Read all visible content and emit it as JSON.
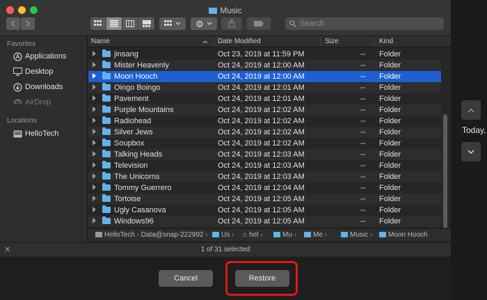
{
  "window": {
    "title": "Music"
  },
  "toolbar": {
    "back_icon": "chevron-left-icon",
    "forward_icon": "chevron-right-icon",
    "views": [
      "icon-view-icon",
      "list-view-icon",
      "column-view-icon",
      "gallery-view-icon"
    ],
    "active_view": 1,
    "search_placeholder": "Search"
  },
  "sidebar": {
    "favorites_header": "Favorites",
    "favorites": [
      {
        "label": "Applications",
        "icon": "applications-icon"
      },
      {
        "label": "Desktop",
        "icon": "desktop-icon"
      },
      {
        "label": "Downloads",
        "icon": "downloads-icon"
      },
      {
        "label": "AirDrop",
        "icon": "airdrop-icon"
      }
    ],
    "locations_header": "Locations",
    "locations": [
      {
        "label": "HelloTech",
        "icon": "computer-icon"
      }
    ]
  },
  "columns": {
    "name": "Name",
    "date": "Date Modified",
    "size": "Size",
    "kind": "Kind"
  },
  "rows": [
    {
      "name": "jinsang",
      "date": "Oct 23, 2019 at 11:59 PM",
      "size": "--",
      "kind": "Folder"
    },
    {
      "name": "Mister Heavenly",
      "date": "Oct 24, 2019 at 12:00 AM",
      "size": "--",
      "kind": "Folder"
    },
    {
      "name": "Moon Hooch",
      "date": "Oct 24, 2019 at 12:00 AM",
      "size": "--",
      "kind": "Folder",
      "selected": true
    },
    {
      "name": "Oingo Boingo",
      "date": "Oct 24, 2019 at 12:01 AM",
      "size": "--",
      "kind": "Folder"
    },
    {
      "name": "Pavement",
      "date": "Oct 24, 2019 at 12:01 AM",
      "size": "--",
      "kind": "Folder"
    },
    {
      "name": "Purple Mountains",
      "date": "Oct 24, 2019 at 12:02 AM",
      "size": "--",
      "kind": "Folder"
    },
    {
      "name": "Radiohead",
      "date": "Oct 24, 2019 at 12:02 AM",
      "size": "--",
      "kind": "Folder"
    },
    {
      "name": "Silver Jews",
      "date": "Oct 24, 2019 at 12:02 AM",
      "size": "--",
      "kind": "Folder"
    },
    {
      "name": "Soupbox",
      "date": "Oct 24, 2019 at 12:02 AM",
      "size": "--",
      "kind": "Folder"
    },
    {
      "name": "Talking Heads",
      "date": "Oct 24, 2019 at 12:03 AM",
      "size": "--",
      "kind": "Folder"
    },
    {
      "name": "Television",
      "date": "Oct 24, 2019 at 12:03 AM",
      "size": "--",
      "kind": "Folder"
    },
    {
      "name": "The Unicorns",
      "date": "Oct 24, 2019 at 12:03 AM",
      "size": "--",
      "kind": "Folder"
    },
    {
      "name": "Tommy Guerrero",
      "date": "Oct 24, 2019 at 12:04 AM",
      "size": "--",
      "kind": "Folder"
    },
    {
      "name": "Tortoise",
      "date": "Oct 24, 2019 at 12:05 AM",
      "size": "--",
      "kind": "Folder"
    },
    {
      "name": "Ugly Casanova",
      "date": "Oct 24, 2019 at 12:05 AM",
      "size": "--",
      "kind": "Folder"
    },
    {
      "name": "Windows96",
      "date": "Oct 24, 2019 at 12:05 AM",
      "size": "--",
      "kind": "Folder"
    }
  ],
  "pathbar": [
    "HelloTech - Data@snap-222992",
    "Us",
    "hel",
    "Mu",
    "Me",
    "Music",
    "Moon Hooch"
  ],
  "status": "1 of 31 selected",
  "buttons": {
    "cancel": "Cancel",
    "restore": "Restore"
  },
  "side_panel": {
    "label": "Today,",
    "up_icon": "chevron-up-icon",
    "down_icon": "chevron-down-icon"
  }
}
